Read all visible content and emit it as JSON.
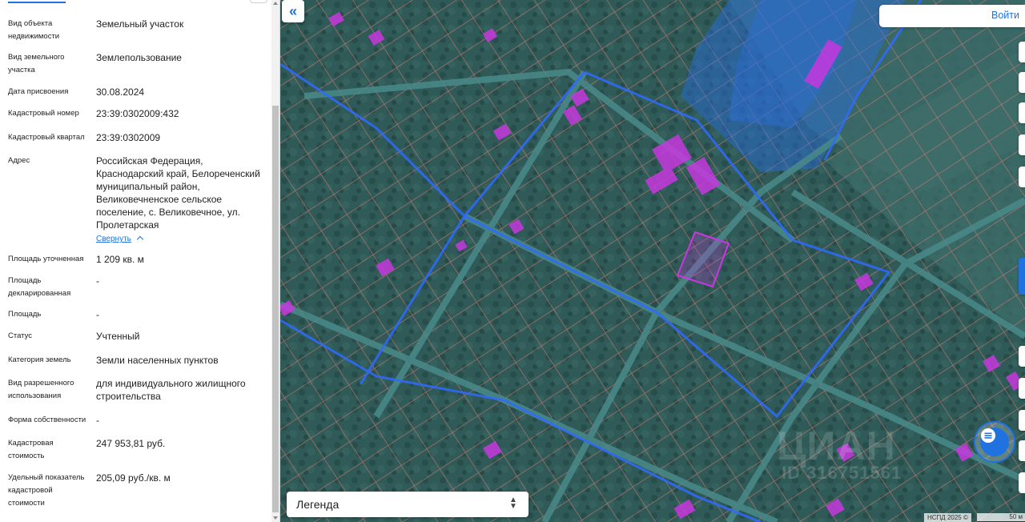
{
  "panel": {
    "properties": [
      {
        "label": "Вид объекта недвижимости",
        "value": "Земельный участок"
      },
      {
        "label": "Вид земельного участка",
        "value": "Землепользование"
      },
      {
        "label": "Дата присвоения",
        "value": "30.08.2024"
      },
      {
        "label": "Кадастровый номер",
        "value": "23:39:0302009:432"
      },
      {
        "label": "Кадастровый квартал",
        "value": "23:39:0302009"
      },
      {
        "label": "Адрес",
        "value": "Российская Федерация, Краснодарский край, Белореченский муниципальный район, Великовечненское сельское поселение, с. Великовечное, ул. Пролетарская"
      },
      {
        "label": "Площадь уточненная",
        "value": "1 209 кв. м"
      },
      {
        "label": "Площадь декларированная",
        "value": "-"
      },
      {
        "label": "Площадь",
        "value": "-"
      },
      {
        "label": "Статус",
        "value": "Учтенный"
      },
      {
        "label": "Категория земель",
        "value": "Земли населенных пунктов"
      },
      {
        "label": "Вид разрешенного использования",
        "value": "для индивидуального жилищного строительства"
      },
      {
        "label": "Форма собственности",
        "value": "-"
      },
      {
        "label": "Кадастровая стоимость",
        "value": "247 953,81 руб."
      },
      {
        "label": "Удельный показатель кадастровой стоимости",
        "value": "205,09 руб./кв. м"
      }
    ],
    "collapse_link": "Свернуть"
  },
  "map": {
    "login_label": "Войти",
    "legend_label": "Легенда",
    "copyright": "НСПД 2025 ©",
    "scale_label": "50 м",
    "watermark_name": "ЦИАН",
    "watermark_id": "ID 316751561",
    "icons": {
      "collapse": "double-chevron-left-icon",
      "chat": "chat-bubble-icon",
      "legend": "sort-chevrons-icon"
    },
    "colors": {
      "accent": "#1f72e0",
      "parcel_border": "#e0766f",
      "quarter_border": "#2f6bff",
      "building_fill": "#c838e0",
      "zone_fill": "#2b6fe6"
    }
  }
}
